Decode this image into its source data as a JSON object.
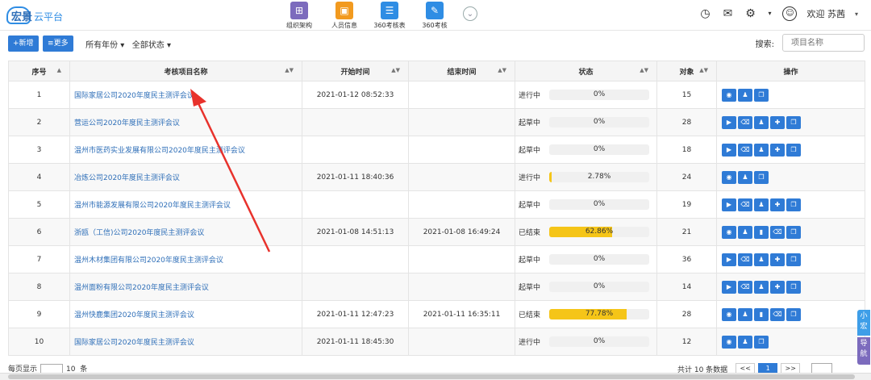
{
  "header": {
    "logo_main": "宏景",
    "logo_sub": "云平台",
    "nav": [
      {
        "label": "组织架构",
        "icon": "org-chart-icon"
      },
      {
        "label": "人员信息",
        "icon": "person-card-icon"
      },
      {
        "label": "360考核表",
        "icon": "form-icon"
      },
      {
        "label": "360考核",
        "icon": "edit-form-icon"
      }
    ],
    "welcome": "欢迎 苏茜"
  },
  "toolbar": {
    "add_label": "+新增",
    "more_label": "≡更多",
    "year_filter": "所有年份 ▾",
    "status_filter": "全部状态 ▾",
    "search_label": "搜索:",
    "search_placeholder": "项目名称"
  },
  "table": {
    "columns": [
      "序号",
      "考核项目名称",
      "开始时间",
      "结束时间",
      "状态",
      "对象",
      "操作"
    ],
    "rows": [
      {
        "no": "1",
        "name": "国际家居公司2020年度民主测评会议",
        "start": "2021-01-12 08:52:33",
        "end": "",
        "status": "进行中",
        "progress": 0,
        "progress_text": "0%",
        "count": "15",
        "ops": [
          "view",
          "person",
          "copy"
        ]
      },
      {
        "no": "2",
        "name": "营运公司2020年度民主测评会议",
        "start": "",
        "end": "",
        "status": "起草中",
        "progress": 0,
        "progress_text": "0%",
        "count": "28",
        "ops": [
          "play",
          "delete",
          "person",
          "user-add",
          "copy"
        ]
      },
      {
        "no": "3",
        "name": "温州市医药实业发展有限公司2020年度民主测评会议",
        "start": "",
        "end": "",
        "status": "起草中",
        "progress": 0,
        "progress_text": "0%",
        "count": "18",
        "ops": [
          "play",
          "delete",
          "person",
          "user-add",
          "copy"
        ]
      },
      {
        "no": "4",
        "name": "冶炼公司2020年度民主测评会议",
        "start": "2021-01-11 18:40:36",
        "end": "",
        "status": "进行中",
        "progress": 2.78,
        "progress_text": "2.78%",
        "count": "24",
        "ops": [
          "view",
          "person",
          "copy"
        ]
      },
      {
        "no": "5",
        "name": "温州市能源发展有限公司2020年度民主测评会议",
        "start": "",
        "end": "",
        "status": "起草中",
        "progress": 0,
        "progress_text": "0%",
        "count": "19",
        "ops": [
          "play",
          "delete",
          "person",
          "user-add",
          "copy"
        ]
      },
      {
        "no": "6",
        "name": "浙瓯（工信)公司2020年度民主测评会议",
        "start": "2021-01-08 14:51:13",
        "end": "2021-01-08 16:49:24",
        "status": "已结束",
        "progress": 62.86,
        "progress_text": "62.86%",
        "count": "21",
        "ops": [
          "view",
          "person",
          "chart",
          "delete",
          "copy"
        ]
      },
      {
        "no": "7",
        "name": "温州木材集团有限公司2020年度民主测评会议",
        "start": "",
        "end": "",
        "status": "起草中",
        "progress": 0,
        "progress_text": "0%",
        "count": "36",
        "ops": [
          "play",
          "delete",
          "person",
          "user-add",
          "copy"
        ]
      },
      {
        "no": "8",
        "name": "温州面粉有限公司2020年度民主测评会议",
        "start": "",
        "end": "",
        "status": "起草中",
        "progress": 0,
        "progress_text": "0%",
        "count": "14",
        "ops": [
          "play",
          "delete",
          "person",
          "user-add",
          "copy"
        ]
      },
      {
        "no": "9",
        "name": "温州快鹿集团2020年度民主测评会议",
        "start": "2021-01-11 12:47:23",
        "end": "2021-01-11 16:35:11",
        "status": "已结束",
        "progress": 77.78,
        "progress_text": "77.78%",
        "count": "28",
        "ops": [
          "view",
          "person",
          "chart",
          "delete",
          "copy"
        ]
      },
      {
        "no": "10",
        "name": "国际家居公司2020年度民主测评会议",
        "start": "2021-01-11 18:45:30",
        "end": "",
        "status": "进行中",
        "progress": 0,
        "progress_text": "0%",
        "count": "12",
        "ops": [
          "view",
          "person",
          "copy"
        ]
      }
    ]
  },
  "footer": {
    "page_size_label": "每页显示",
    "page_size": "10",
    "page_size_unit": "条",
    "total_text": "共计 10 条数据",
    "current_page": "1"
  },
  "sidetab": {
    "top": "小宏",
    "bottom": "导航"
  },
  "colors": {
    "accent": "#2f7bd6",
    "progress": "#f5c518",
    "link": "#2f6fb8"
  }
}
